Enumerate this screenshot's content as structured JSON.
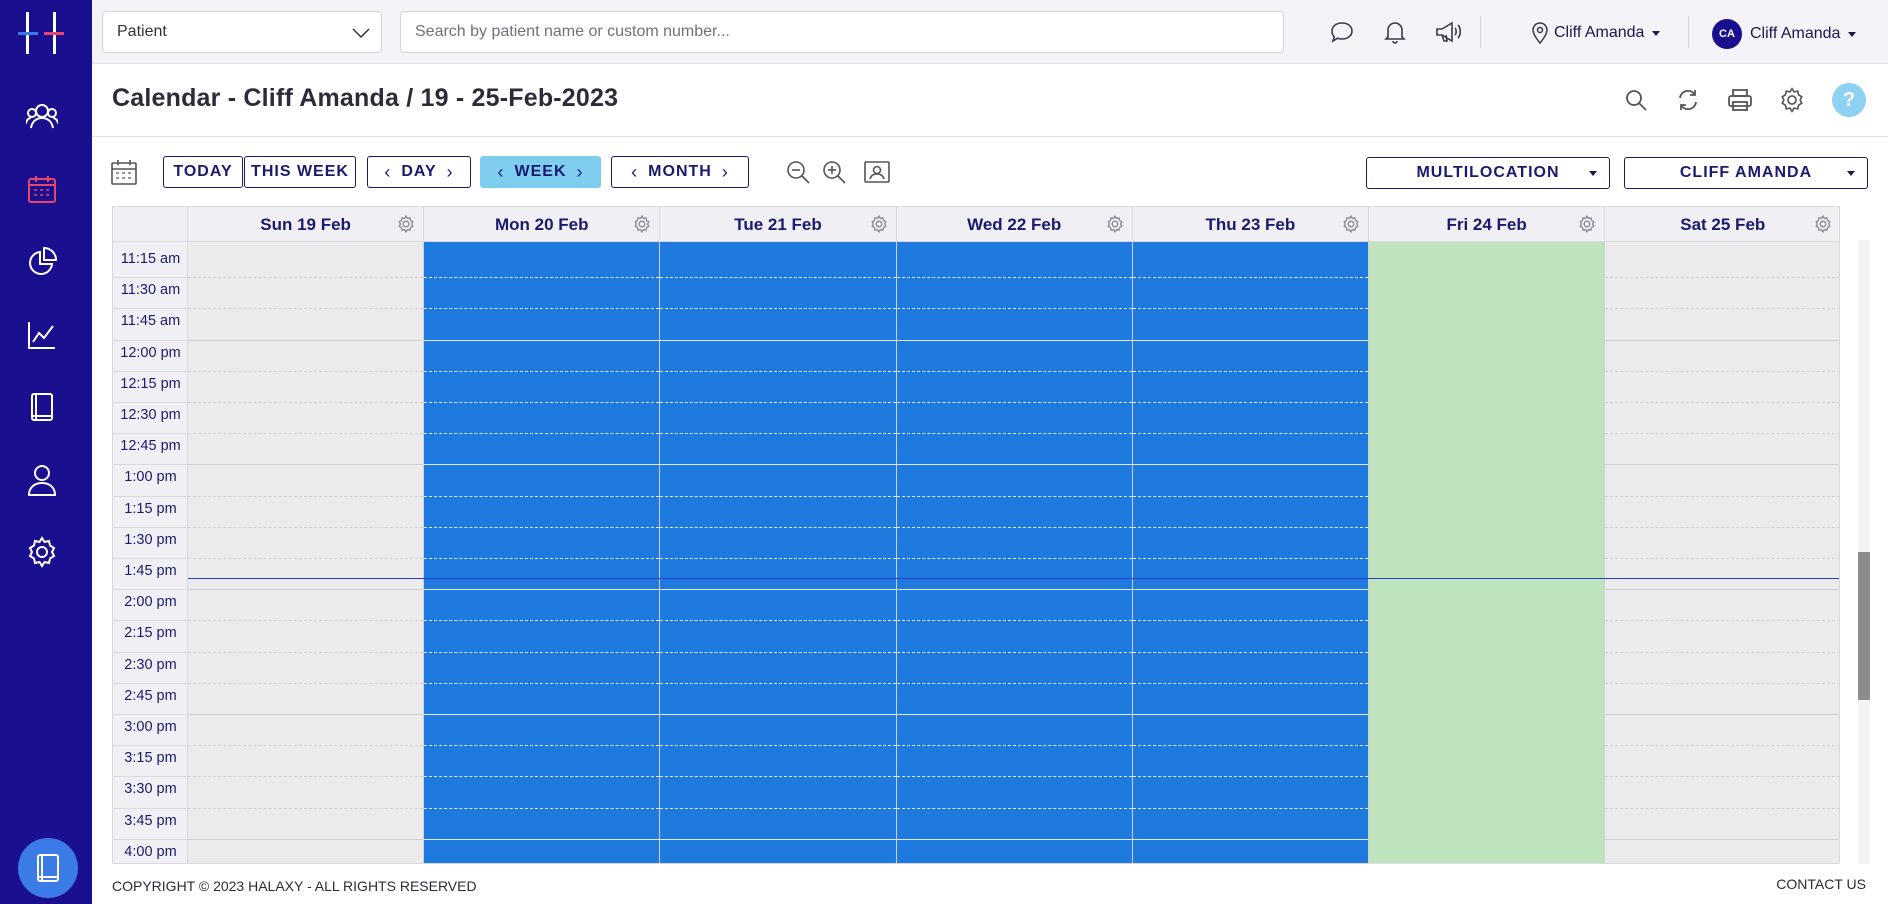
{
  "topbar": {
    "patient_select": "Patient",
    "search_placeholder": "Search by patient name or custom number...",
    "location": "Cliff Amanda",
    "user": "Cliff Amanda",
    "avatar_initials": "CA"
  },
  "page": {
    "title": "Calendar - Cliff Amanda / 19 - 25-Feb-2023"
  },
  "toolbar": {
    "today": "TODAY",
    "this_week": "THIS WEEK",
    "day": "DAY",
    "week": "WEEK",
    "month": "MONTH",
    "multilocation": "MULTILOCATION",
    "practitioner": "CLIFF AMANDA",
    "active_view": "week"
  },
  "calendar": {
    "days": [
      {
        "label": "Sun 19 Feb",
        "state": "closed"
      },
      {
        "label": "Mon 20 Feb",
        "state": "booked"
      },
      {
        "label": "Tue 21 Feb",
        "state": "booked"
      },
      {
        "label": "Wed 22 Feb",
        "state": "booked"
      },
      {
        "label": "Thu 23 Feb",
        "state": "booked"
      },
      {
        "label": "Fri 24 Feb",
        "state": "available"
      },
      {
        "label": "Sat 25 Feb",
        "state": "closed"
      }
    ],
    "times": [
      "11:15 am",
      "11:30 am",
      "11:45 am",
      "12:00 pm",
      "12:15 pm",
      "12:30 pm",
      "12:45 pm",
      "1:00 pm",
      "1:15 pm",
      "1:30 pm",
      "1:45 pm",
      "2:00 pm",
      "2:15 pm",
      "2:30 pm",
      "2:45 pm",
      "3:00 pm",
      "3:15 pm",
      "3:30 pm",
      "3:45 pm",
      "4:00 pm"
    ],
    "colors": {
      "closed": "#ebebeb",
      "booked": "#1f7ae0",
      "available": "#bfe3bd",
      "now_line": "#2a3bd0"
    }
  },
  "footer": {
    "copyright": "COPYRIGHT © 2023 HALAXY - ALL RIGHTS RESERVED",
    "contact": "CONTACT US"
  },
  "icons": {
    "sidenav": [
      "contacts-icon",
      "calendar-icon",
      "reports-pie-icon",
      "analytics-icon",
      "book-icon",
      "user-icon",
      "settings-icon"
    ]
  }
}
